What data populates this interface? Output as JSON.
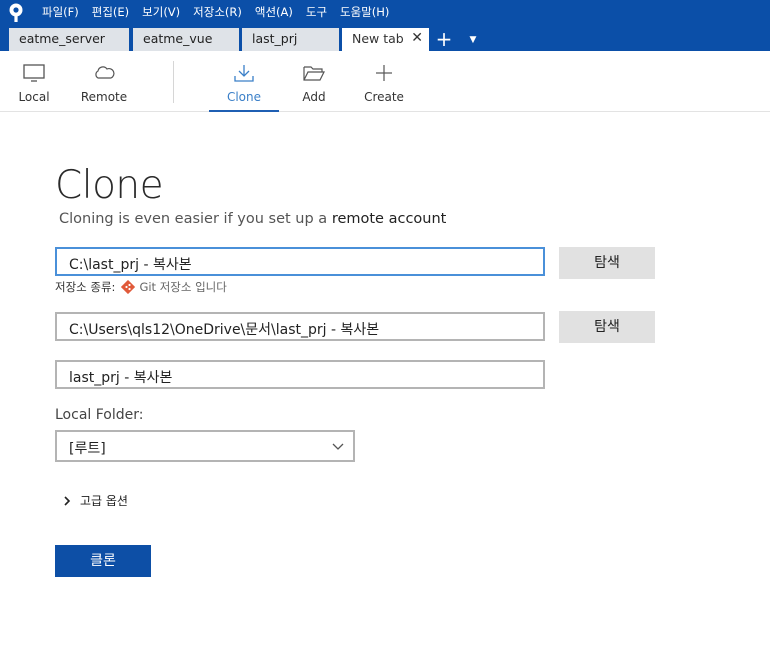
{
  "menu": [
    "파일(F)",
    "편집(E)",
    "보기(V)",
    "저장소(R)",
    "액션(A)",
    "도구",
    "도움말(H)"
  ],
  "tabs": [
    "eatme_server",
    "eatme_vue",
    "last_prj",
    "New tab"
  ],
  "tab_close": "✕",
  "tab_add": "+",
  "tab_menu": "▼",
  "toolbar": {
    "local": "Local",
    "remote": "Remote",
    "clone": "Clone",
    "add": "Add",
    "create": "Create"
  },
  "page": {
    "title": "Clone",
    "subtitle_prefix": "Cloning is even easier if you set up a ",
    "subtitle_link": "remote account"
  },
  "source_url": "C:\\last_prj - 복사본",
  "browse_label": "탐색",
  "repo_type_label": "저장소 종류:",
  "repo_type_value": "Git 저장소 입니다",
  "destination_path": "C:\\Users\\qls12\\OneDrive\\문서\\last_prj - 복사본",
  "name": "last_prj - 복사본",
  "local_folder_label": "Local Folder:",
  "local_folder_value": "[루트]",
  "advanced_options": "고급 옵션",
  "clone_button": "클론",
  "colors": {
    "titlebar": "#0b4fa8",
    "accent": "#1f5fb3",
    "primary_button": "#0d4fa6",
    "git": "#e05a3a"
  }
}
